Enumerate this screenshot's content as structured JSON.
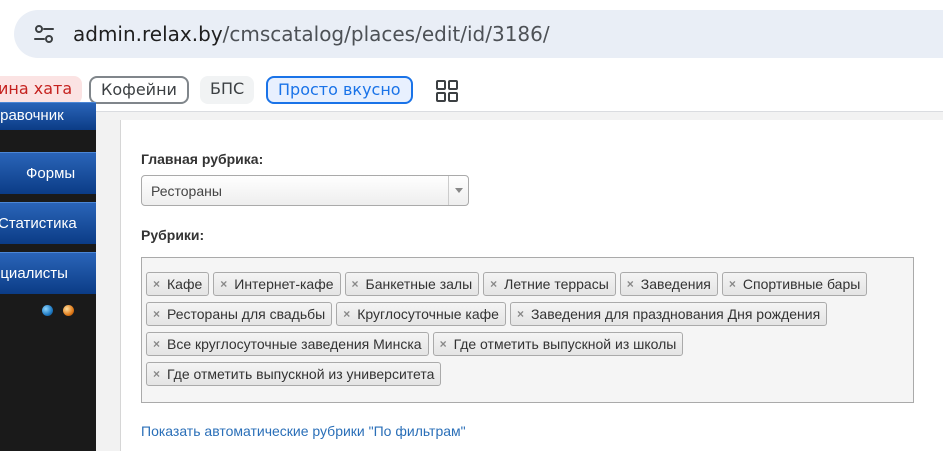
{
  "browser": {
    "url_host": "admin.relax.by",
    "url_path": "/cmscatalog/places/edit/id/3186/",
    "site_icon": "tune-icon"
  },
  "bookmarks": {
    "items": [
      {
        "label": "ина хата"
      },
      {
        "label": "Кофейни"
      },
      {
        "label": "БПС"
      },
      {
        "label": "Просто вкусно"
      }
    ],
    "apps_icon": "apps-grid-icon"
  },
  "sidebar": {
    "items": [
      {
        "label": "правочник"
      },
      {
        "label": "Формы"
      },
      {
        "label": "Статистика"
      },
      {
        "label": "ециалисты"
      }
    ]
  },
  "form": {
    "main_category_label": "Главная рубрика:",
    "main_category_value": "Рестораны",
    "categories_label": "Рубрики:",
    "tags": [
      "Кафе",
      "Интернет-кафе",
      "Банкетные залы",
      "Летние террасы",
      "Заведения",
      "Спортивные бары",
      "Рестораны для свадьбы",
      "Круглосуточные кафе",
      "Заведения для празднования Дня рождения",
      "Все круглосуточные заведения Минска",
      "Где отметить выпускной из школы",
      "Где отметить выпускной из университета"
    ],
    "tag_remove_symbol": "×",
    "auto_categories_link": "Показать автоматические рубрики \"По фильтрам\""
  },
  "colors": {
    "nav_blue": "#0b3c86",
    "link": "#2a6fb8",
    "bookmark_blue": "#1a73e8",
    "bookmark_red": "#c5221f"
  }
}
